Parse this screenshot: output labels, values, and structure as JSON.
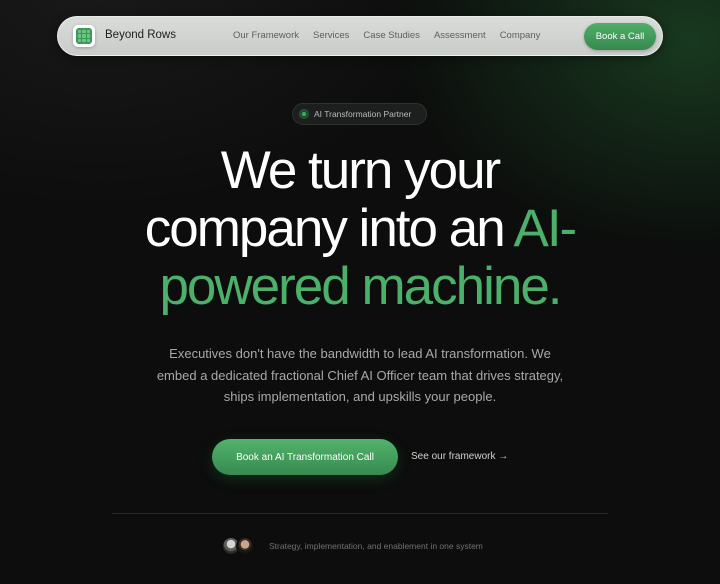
{
  "nav": {
    "brand": "Beyond Rows",
    "logo_icon": "grid-logo-icon",
    "links": [
      "Our Framework",
      "Services",
      "Case Studies",
      "Assessment",
      "Company"
    ],
    "cta_label": "Book a Call"
  },
  "badge": {
    "label": "AI Transformation Partner"
  },
  "hero": {
    "headline_line1": "We turn your",
    "headline_line2_plain": "company into an ",
    "headline_line2_accent": "AI-",
    "headline_line3_accent": "powered machine.",
    "subtext": "Executives don't have the bandwidth to lead AI transformation. We embed a dedicated fractional Chief AI Officer team that drives strategy, ships implementation, and upskills your people.",
    "primary_cta": "Book an AI Transformation Call",
    "secondary_cta": "See our framework →"
  },
  "trust": {
    "text": "Strategy, implementation, and enablement in one system"
  },
  "colors": {
    "accent": "#4caf6a",
    "background": "#0c0d0c",
    "nav_bg": "#d4d7d4"
  }
}
